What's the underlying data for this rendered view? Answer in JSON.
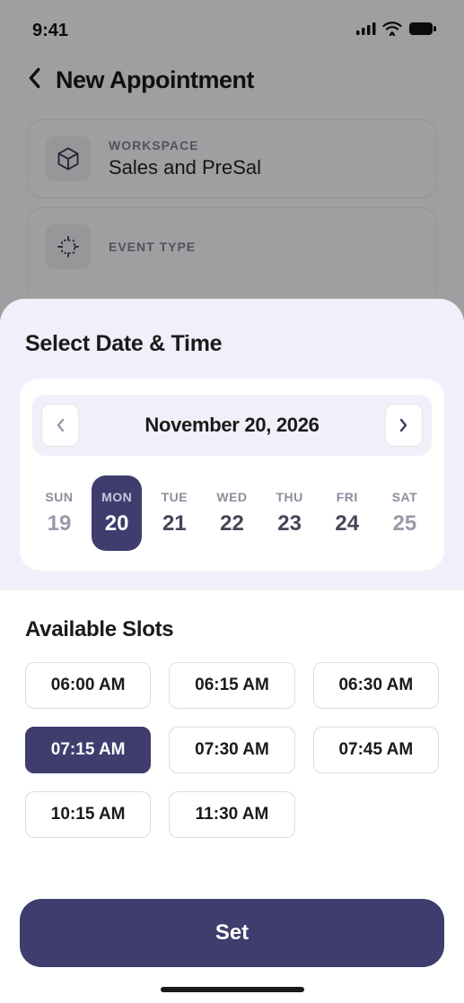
{
  "status": {
    "time": "9:41"
  },
  "header": {
    "title": "New Appointment"
  },
  "workspace": {
    "label": "WORKSPACE",
    "value": "Sales and PreSal"
  },
  "event_type": {
    "label": "EVENT TYPE"
  },
  "sheet": {
    "title": "Select Date & Time",
    "calendar": {
      "date_label": "November 20, 2026",
      "days": [
        {
          "dow": "SUN",
          "num": "19",
          "selected": false,
          "dimmed": true
        },
        {
          "dow": "MON",
          "num": "20",
          "selected": true,
          "dimmed": false
        },
        {
          "dow": "TUE",
          "num": "21",
          "selected": false,
          "dimmed": false
        },
        {
          "dow": "WED",
          "num": "22",
          "selected": false,
          "dimmed": false
        },
        {
          "dow": "THU",
          "num": "23",
          "selected": false,
          "dimmed": false
        },
        {
          "dow": "FRI",
          "num": "24",
          "selected": false,
          "dimmed": false
        },
        {
          "dow": "SAT",
          "num": "25",
          "selected": false,
          "dimmed": true
        }
      ]
    },
    "slots": {
      "title": "Available Slots",
      "items": [
        {
          "label": "06:00 AM",
          "selected": false
        },
        {
          "label": "06:15 AM",
          "selected": false
        },
        {
          "label": "06:30 AM",
          "selected": false
        },
        {
          "label": "07:15 AM",
          "selected": true
        },
        {
          "label": "07:30 AM",
          "selected": false
        },
        {
          "label": "07:45 AM",
          "selected": false
        },
        {
          "label": "10:15 AM",
          "selected": false
        },
        {
          "label": "11:30 AM",
          "selected": false
        }
      ]
    },
    "set_button": "Set"
  }
}
